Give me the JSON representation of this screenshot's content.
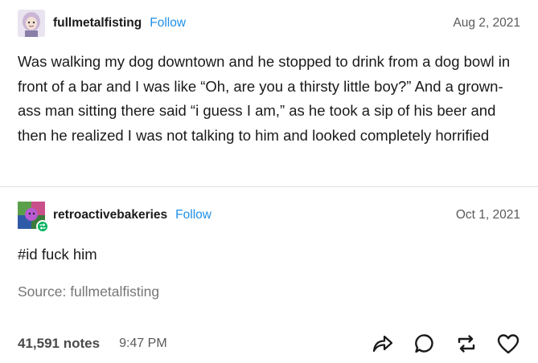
{
  "post": {
    "author": "fullmetalfisting",
    "follow_label": "Follow",
    "date": "Aug 2, 2021",
    "text": "Was walking my dog downtown and he stopped to drink from a dog bowl in front of a bar and I was like “Oh, are you a thirsty little boy?” And a grown-ass man sitting there said “i guess I am,” as he took a sip of his beer and then he realized I was not talking to him and looked completely horrified"
  },
  "reblog": {
    "author": "retroactivebakeries",
    "follow_label": "Follow",
    "date": "Oct 1, 2021",
    "text": "#id fuck him"
  },
  "source": {
    "label": "Source:",
    "name": "fullmetalfisting"
  },
  "footer": {
    "notes": "41,591 notes",
    "time": "9:47 PM"
  },
  "icons": {
    "share": "share-icon",
    "reply": "reply-icon",
    "reblog": "reblog-icon",
    "like": "heart-icon",
    "reblog_badge": "reblog-badge-icon"
  },
  "colors": {
    "follow": "#1f8fe8",
    "reblog_badge": "#00b35c",
    "text": "#1a1a1a",
    "muted": "#767676"
  }
}
